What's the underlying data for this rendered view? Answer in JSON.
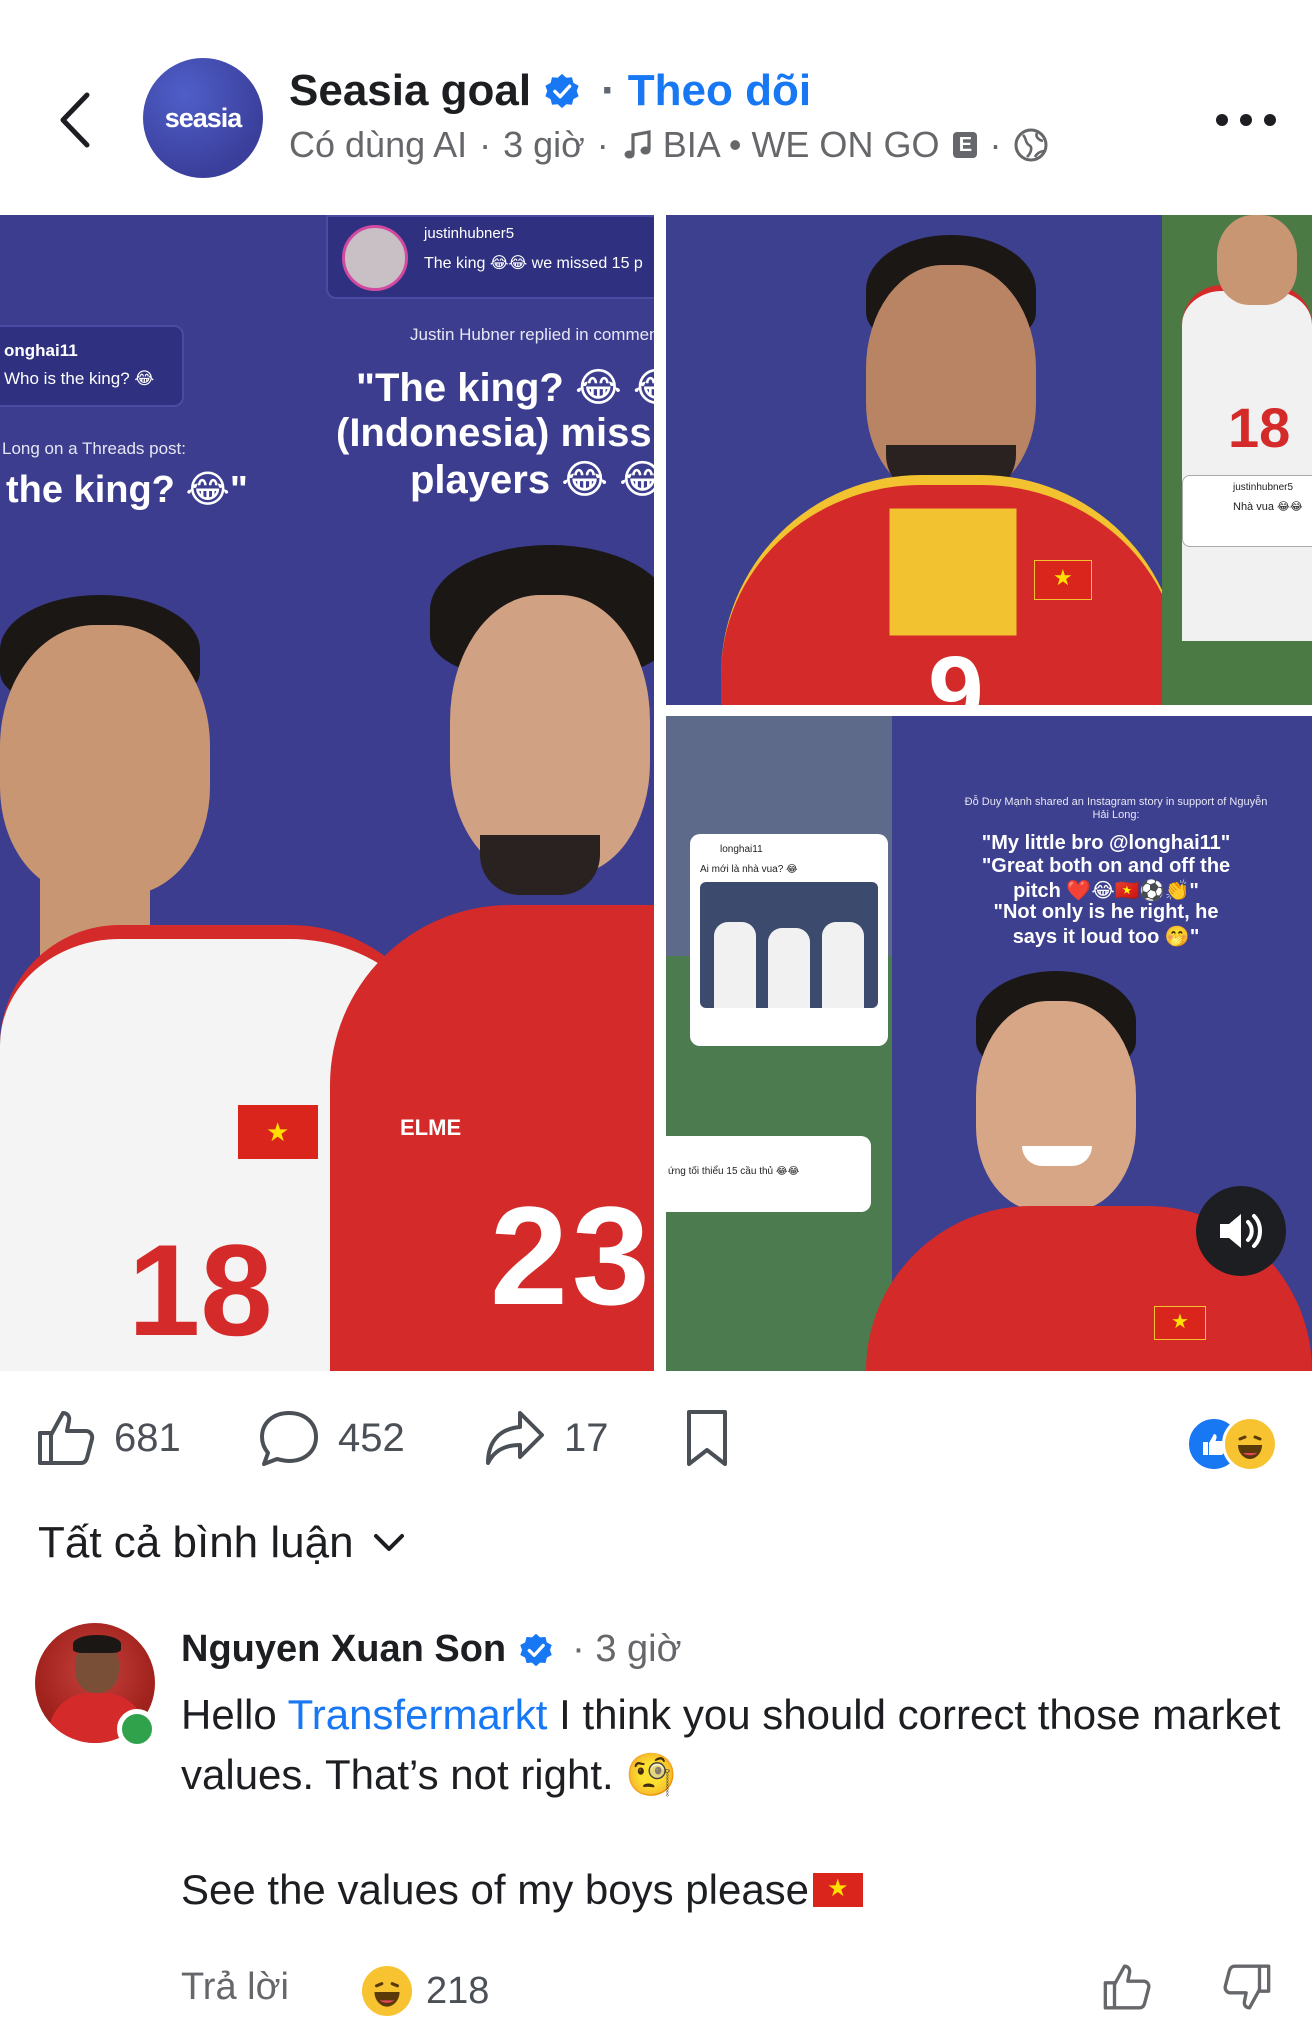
{
  "header": {
    "back_icon": "chevron-left-icon",
    "avatar_text": "seasia",
    "page_name": "Seasia goal",
    "separator": "·",
    "follow_label": "Theo dõi",
    "meta_ai": "Có dùng AI",
    "meta_time": "3 giờ",
    "meta_music": "BIA • WE ON GO",
    "explicit_badge": "E",
    "more_icon": "more-horizontal-icon"
  },
  "post_images": {
    "img1": {
      "comment_user_left": "onghai11",
      "comment_text_left": "Who is the king? 😂",
      "threads_caption": "Long on a Threads post:",
      "threads_quote": "the king? 😂\"",
      "insta_user": "justinhubner5",
      "insta_comment": "The king 😂😂 we missed 15 p",
      "insta_caption": "Justin Hubner replied in comments section on Instagra",
      "quote_line1": "\"The king? 😂 😂",
      "quote_line2": "(Indonesia) miss",
      "quote_line3": "players 😂 😂",
      "jersey_number_left": "18",
      "jersey_number_right": "23",
      "sponsor": "ELME"
    },
    "img2": {
      "jersey_number": "9",
      "jersey_number_side": "18",
      "insta_user": "justinhubner5",
      "insta_text": "Nhà vua 😂😂"
    },
    "img3": {
      "caption_small": "Đỗ Duy Mạnh shared an Instagram story in support of Nguyễn Hải Long:",
      "quote_line1": "\"My little bro @longhai11\"",
      "quote_line2": "\"Great both on and off the",
      "quote_line3": "pitch ❤️😂🇻🇳⚽👏\"",
      "quote_line4": "\"Not only is he right, he",
      "quote_line5": "says it loud too 🤭\"",
      "threads_user": "longhai11",
      "threads_text": "Ai mới là nhà vua? 😂",
      "threads_comment": "ứng tối thiểu 15 cầu thủ 😂😂"
    },
    "sound_icon": "volume-icon"
  },
  "actions": {
    "like_count": "681",
    "comment_count": "452",
    "share_count": "17",
    "like_icon": "thumbs-up-icon",
    "comment_icon": "comment-icon",
    "share_icon": "share-icon",
    "save_icon": "bookmark-icon",
    "reaction_like_icon": "like-reaction-icon",
    "reaction_haha_icon": "haha-reaction-icon"
  },
  "comments_section": {
    "filter_label": "Tất cả bình luận",
    "filter_icon": "chevron-down-icon"
  },
  "comment": {
    "author": "Nguyen Xuan Son",
    "time": "· 3 giờ",
    "text_before_link": "Hello ",
    "link_text": "Transfermarkt",
    "text_after_link": " I think you should correct those market values. That’s not right. 🧐",
    "text_line2": "See the values of my boys please",
    "reply_label": "Trả lời",
    "reaction_count": "218",
    "upvote_icon": "thumbs-up-icon",
    "downvote_icon": "thumbs-down-icon"
  },
  "colors": {
    "accent": "#1877f2",
    "image_bg": "#3d3f8f",
    "red_jersey": "#d42a2a",
    "online": "#31a24c"
  }
}
